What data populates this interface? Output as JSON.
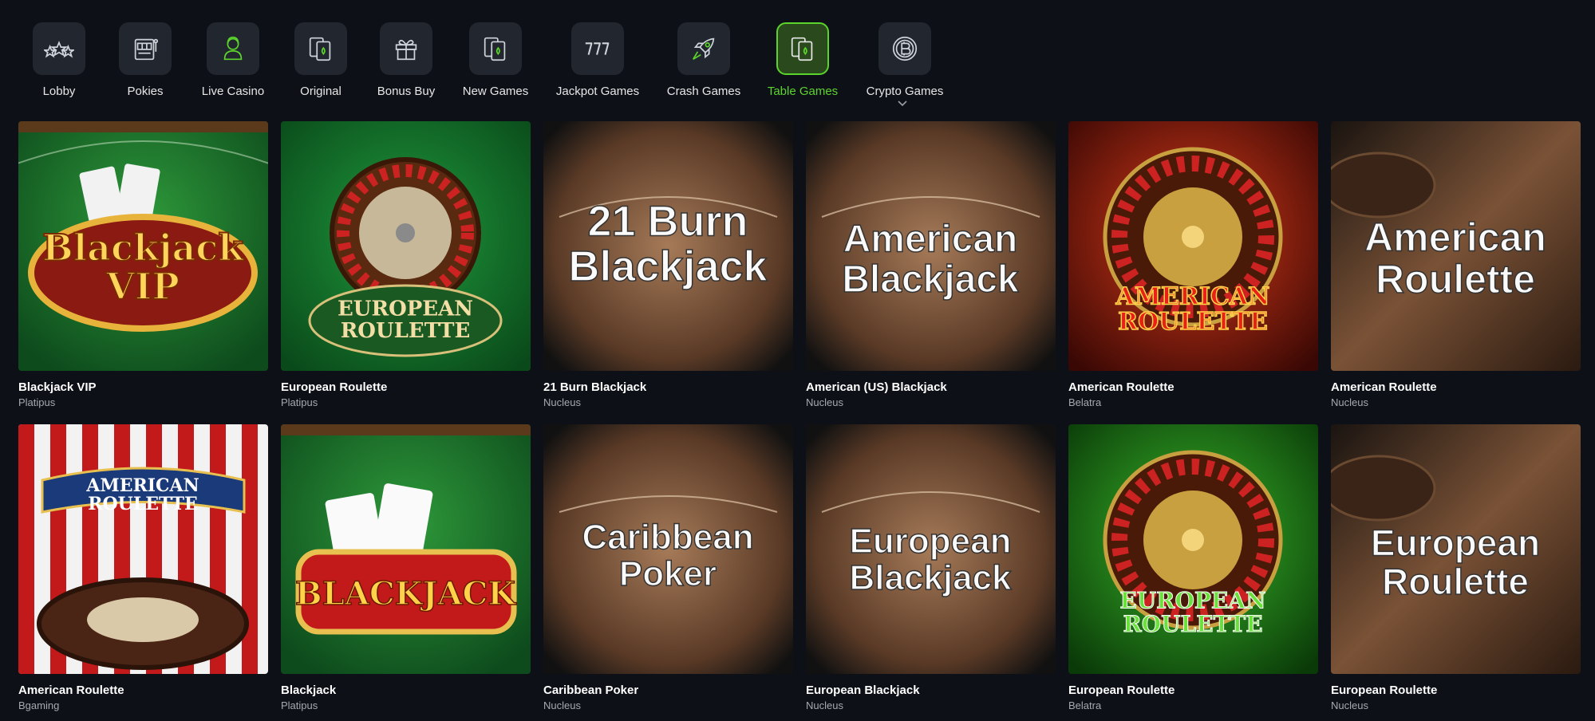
{
  "categories": [
    {
      "label": "Lobby",
      "icon": "stars-icon",
      "active": false
    },
    {
      "label": "Pokies",
      "icon": "slot-machine-icon",
      "active": false
    },
    {
      "label": "Live Casino",
      "icon": "live-dealer-icon",
      "active": false
    },
    {
      "label": "Original",
      "icon": "cards-icon",
      "active": false
    },
    {
      "label": "Bonus Buy",
      "icon": "gift-icon",
      "active": false
    },
    {
      "label": "New Games",
      "icon": "cards-icon",
      "active": false
    },
    {
      "label": "Jackpot Games",
      "icon": "jackpot-777-icon",
      "active": false
    },
    {
      "label": "Crash Games",
      "icon": "rocket-icon",
      "active": false
    },
    {
      "label": "Table Games",
      "icon": "cards-icon",
      "active": true
    },
    {
      "label": "Crypto Games",
      "icon": "bitcoin-icon",
      "active": false
    }
  ],
  "colors": {
    "accent": "#5bd42c",
    "background": "#0d1117",
    "tile": "#22262e"
  },
  "games": [
    {
      "title": "Blackjack VIP",
      "provider": "Platipus",
      "art": "Blackjack VIP"
    },
    {
      "title": "European Roulette",
      "provider": "Platipus",
      "art": "EUROPEAN ROULETTE"
    },
    {
      "title": "21 Burn Blackjack",
      "provider": "Nucleus",
      "art": "21 Burn Blackjack"
    },
    {
      "title": "American (US) Blackjack",
      "provider": "Nucleus",
      "art": "American Blackjack"
    },
    {
      "title": "American Roulette",
      "provider": "Belatra",
      "art": "AMERICAN ROULETTE"
    },
    {
      "title": "American Roulette",
      "provider": "Nucleus",
      "art": "American Roulette"
    },
    {
      "title": "American Roulette",
      "provider": "Bgaming",
      "art": "AMERICAN ROULETTE"
    },
    {
      "title": "Blackjack",
      "provider": "Platipus",
      "art": "BLACKJACK"
    },
    {
      "title": "Caribbean Poker",
      "provider": "Nucleus",
      "art": "Caribbean Poker"
    },
    {
      "title": "European Blackjack",
      "provider": "Nucleus",
      "art": "European Blackjack"
    },
    {
      "title": "European Roulette",
      "provider": "Belatra",
      "art": "EUROPEAN ROULETTE"
    },
    {
      "title": "European Roulette",
      "provider": "Nucleus",
      "art": "European Roulette"
    }
  ]
}
